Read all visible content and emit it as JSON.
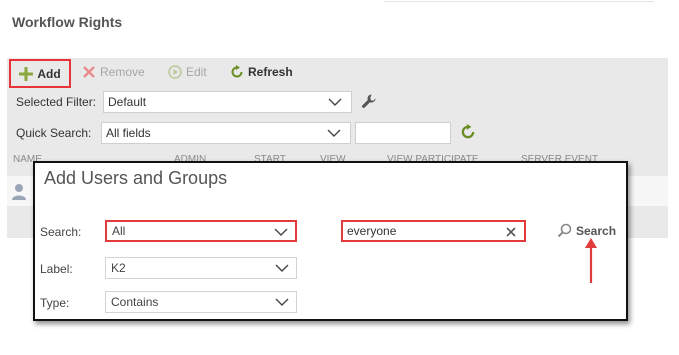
{
  "page": {
    "title": "Workflow Rights"
  },
  "toolbar": {
    "add_label": "Add",
    "remove_label": "Remove",
    "edit_label": "Edit",
    "refresh_label": "Refresh"
  },
  "filters": {
    "selected_filter_label": "Selected Filter:",
    "selected_filter_value": "Default",
    "quick_search_label": "Quick Search:",
    "quick_search_value": "All fields",
    "quick_search_text": ""
  },
  "table": {
    "columns": [
      "NAME",
      "ADMIN",
      "START",
      "VIEW",
      "VIEW PARTICIPATE",
      "SERVER EVENT"
    ]
  },
  "dialog": {
    "title": "Add Users and Groups",
    "search_label": "Search:",
    "search_scope_value": "All",
    "search_text": "everyone",
    "search_button_label": "Search",
    "label_label": "Label:",
    "label_value": "K2",
    "type_label": "Type:",
    "type_value": "Contains"
  },
  "colors": {
    "highlight": "#e23b3b",
    "add_icon": "#8aa63c",
    "refresh_icon": "#6b8e23",
    "panel": "#e9e9e9"
  },
  "icons": [
    "plus-icon",
    "x-icon",
    "play-circle-icon",
    "refresh-icon",
    "wrench-icon",
    "user-icon",
    "chevron-down-icon",
    "clear-icon",
    "magnifier-icon",
    "arrow-up-icon"
  ]
}
